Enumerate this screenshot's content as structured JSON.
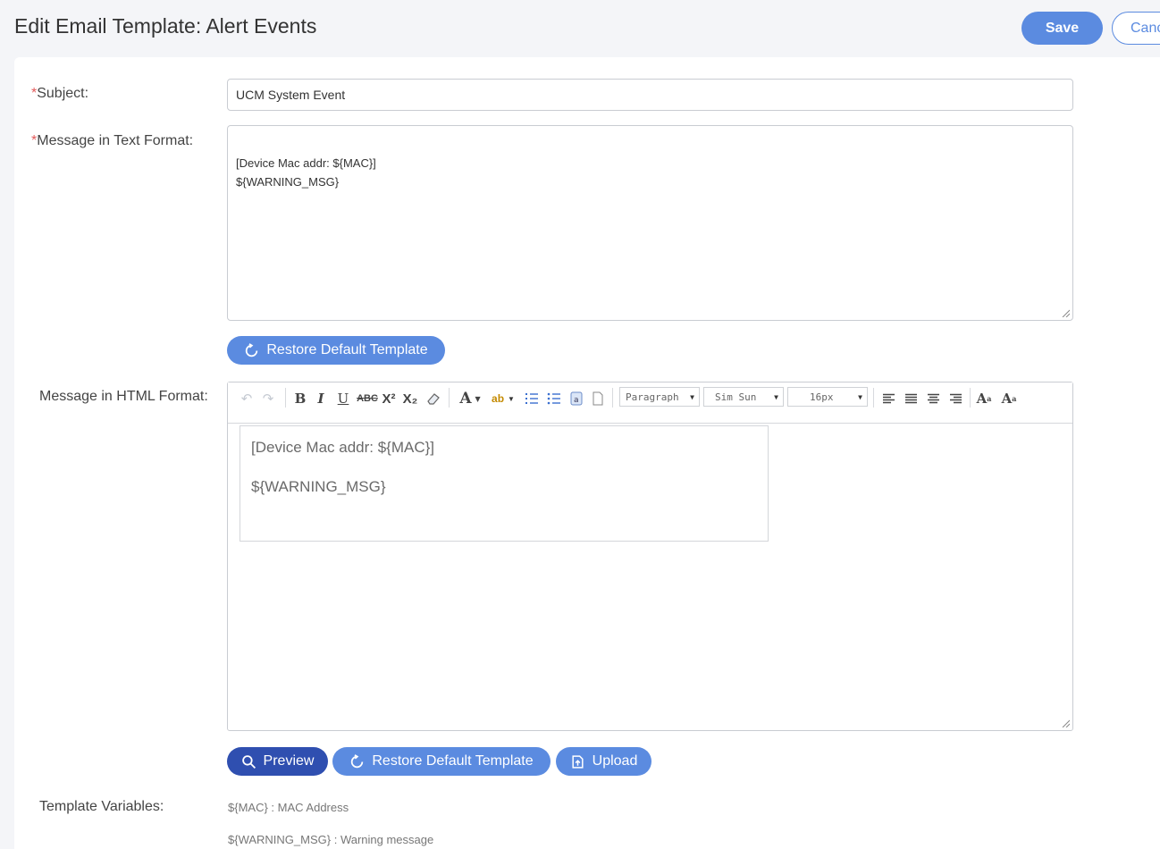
{
  "header": {
    "title": "Edit Email Template: Alert Events",
    "save_label": "Save",
    "cancel_label": "Cancel"
  },
  "form": {
    "subject_label": "Subject:",
    "subject_value": "UCM System Event",
    "text_label": "Message in Text Format:",
    "text_value": "[Device Mac addr: ${MAC}]\n${WARNING_MSG}",
    "restore_label": "Restore Default Template",
    "html_label": "Message in HTML Format:",
    "html_lines": [
      "[Device Mac addr: ${MAC}]",
      "${WARNING_MSG}"
    ],
    "toolbar": {
      "paragraph": "Paragraph",
      "font": "Sim Sun",
      "size": "16px"
    },
    "preview_label": "Preview",
    "restore2_label": "Restore Default Template",
    "upload_label": "Upload"
  },
  "variables": {
    "label": "Template Variables:",
    "items": [
      "${MAC} : MAC Address",
      "${WARNING_MSG} : Warning message"
    ]
  },
  "colors": {
    "accent": "#5b8be0",
    "accent_dark": "#2f4fb0",
    "required": "#e35a5a"
  }
}
